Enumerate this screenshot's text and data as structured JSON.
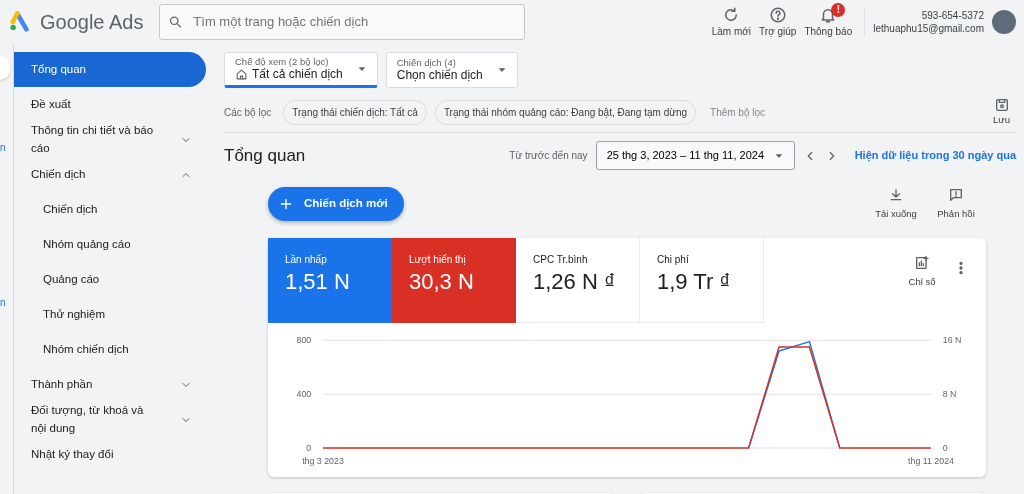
{
  "header": {
    "logo_text": "Google Ads",
    "search": {
      "placeholder": "Tìm một trang hoặc chiến dịch"
    },
    "actions": [
      {
        "kind": "refresh",
        "label": "Làm mới"
      },
      {
        "kind": "help",
        "label": "Trợ giúp"
      },
      {
        "kind": "bell",
        "label": "Thông báo",
        "badge": "!"
      }
    ],
    "account": {
      "phone": "593-654-5372",
      "email": "lethuaphu15@gmail.com"
    }
  },
  "rail": {
    "fragments": [
      "n",
      "n"
    ]
  },
  "sidebar": {
    "items": [
      {
        "label": "Tổng quan",
        "selected": true
      },
      {
        "label": "Đề xuất",
        "selected": false
      },
      {
        "label": "Thông tin chi tiết và báo cáo",
        "selected": false,
        "expanded": false
      },
      {
        "label": "Chiến dịch",
        "selected": false,
        "expanded": true,
        "children": [
          {
            "label": "Chiến dịch",
            "selected": false
          },
          {
            "label": "Nhóm quảng cáo",
            "selected": false
          },
          {
            "label": "Quảng cáo",
            "selected": false
          },
          {
            "label": "Thử nghiệm",
            "selected": false
          },
          {
            "label": "Nhóm chiến dịch",
            "selected": false
          }
        ]
      },
      {
        "label": "Thành phần",
        "selected": false,
        "expanded": false
      },
      {
        "label": "Đối tượng, từ khoá và nội dung",
        "selected": false,
        "expanded": false
      },
      {
        "label": "Nhật ký thay đổi",
        "selected": false
      }
    ]
  },
  "selectors": [
    {
      "caption": "Chế độ xem (2 bộ lọc)",
      "value": "Tất cả chiến dịch",
      "kind": "view",
      "selected": true
    },
    {
      "caption": "Chiến dịch (4)",
      "value": "Chọn chiến dịch",
      "kind": "campaign",
      "selected": false
    }
  ],
  "filters": {
    "label": "Các bộ lọc",
    "chips": [
      "Trạng thái chiến dịch: Tất cả",
      "Trạng thái nhóm quảng cáo: Đang bật, Đang tạm dừng"
    ],
    "add": "Thêm bộ lọc",
    "save": "Lưu"
  },
  "title": "Tổng quan",
  "date": {
    "preset": "Từ trước đến nay",
    "range": "25 thg 3, 2023 – 11 thg 11, 2024",
    "link": "Hiện dữ liệu trong 30 ngày qua"
  },
  "new_campaign": "Chiến dịch mới",
  "tools": [
    {
      "kind": "download",
      "label": "Tải xuống"
    },
    {
      "kind": "feedback",
      "label": "Phản hồi"
    }
  ],
  "metrics": [
    {
      "label": "Lần nhấp",
      "value": "1,51 N",
      "selected": true,
      "color": "#1a73e8"
    },
    {
      "label": "Lượt hiển thị",
      "value": "30,3 N",
      "selected": true,
      "color": "#d93025"
    },
    {
      "label": "CPC Tr.bình",
      "value": "1,26 N ₫",
      "selected": false
    },
    {
      "label": "Chi phí",
      "value": "1,9 Tr ₫",
      "selected": false
    }
  ],
  "metrics_button": "Chỉ số",
  "chart_data": {
    "type": "line",
    "categories": [
      "thg 3 2023",
      null,
      null,
      null,
      null,
      null,
      null,
      null,
      null,
      null,
      null,
      null,
      null,
      null,
      null,
      null,
      null,
      null,
      null,
      null,
      "thg 11 2024"
    ],
    "ylim": [
      0,
      800
    ],
    "yticks": [
      0,
      400,
      800
    ],
    "y2lim": [
      0,
      16
    ],
    "y2ticks": [
      {
        "value": 0,
        "label": "0"
      },
      {
        "value": 8,
        "label": "8 N"
      },
      {
        "value": 16,
        "label": "16 N"
      }
    ],
    "series": [
      {
        "color": "#1a73e8",
        "values": [
          null,
          null,
          null,
          null,
          null,
          null,
          null,
          null,
          null,
          null,
          null,
          null,
          null,
          null,
          0,
          720,
          790,
          0,
          null,
          null,
          null
        ]
      },
      {
        "color": "#d93025",
        "axis": "y2",
        "values": [
          0,
          0,
          0,
          0,
          0,
          0,
          0,
          0,
          0,
          0,
          0,
          0,
          0,
          0,
          0,
          15,
          15,
          0,
          0,
          0,
          0
        ]
      }
    ]
  }
}
